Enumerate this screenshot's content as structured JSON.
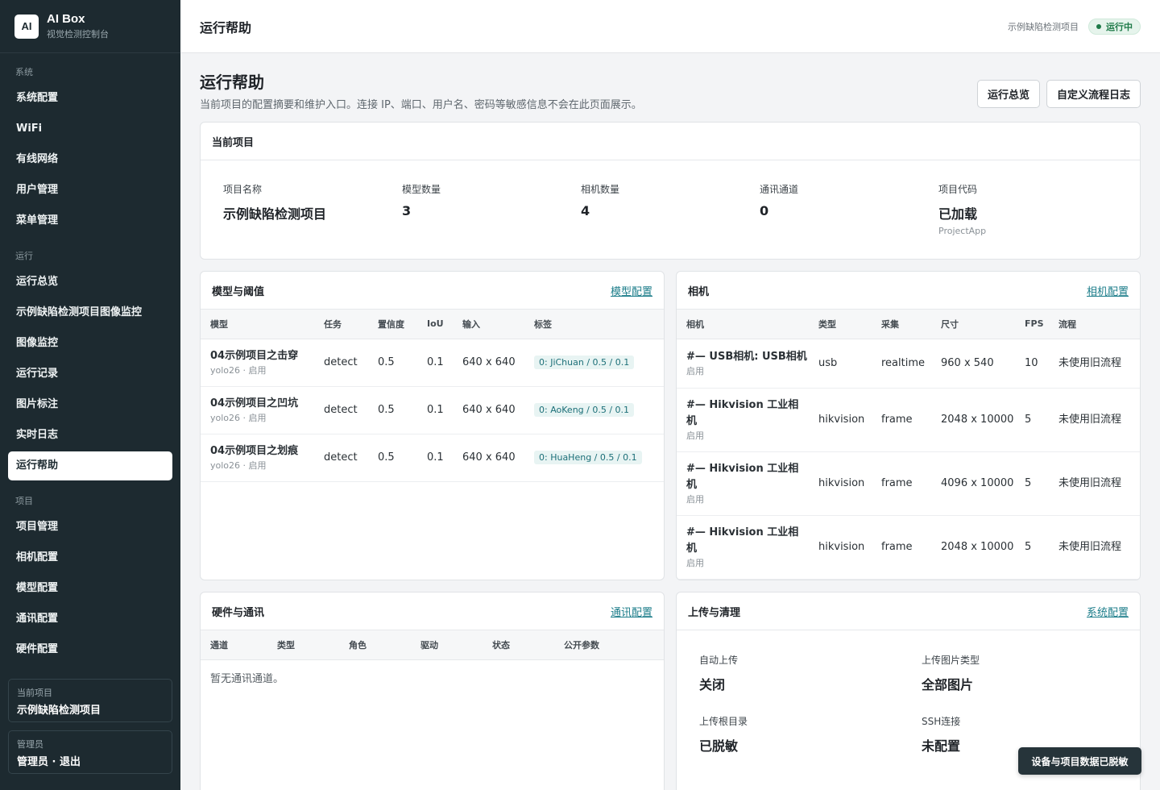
{
  "brand": {
    "logo": "AI",
    "name": "AI Box",
    "subtitle": "视觉检测控制台"
  },
  "sidebar": {
    "groups": [
      {
        "label": "系统",
        "items": [
          "系统配置",
          "WiFi",
          "有线网络",
          "用户管理",
          "菜单管理"
        ]
      },
      {
        "label": "运行",
        "items": [
          "运行总览",
          "示例缺陷检测项目图像监控",
          "图像监控",
          "运行记录",
          "图片标注",
          "实时日志",
          "运行帮助"
        ]
      },
      {
        "label": "项目",
        "items": [
          "项目管理",
          "相机配置",
          "模型配置",
          "通讯配置",
          "硬件配置"
        ]
      }
    ],
    "active": "运行帮助",
    "current_project": {
      "label": "当前项目",
      "value": "示例缺陷检测项目"
    },
    "admin": {
      "label": "管理员",
      "value": "管理员 · 退出"
    }
  },
  "topbar": {
    "title": "运行帮助",
    "project": "示例缺陷检测项目",
    "status": "运行中"
  },
  "page": {
    "title": "运行帮助",
    "description": "当前项目的配置摘要和维护入口。连接 IP、端口、用户名、密码等敏感信息不会在此页面展示。",
    "btn_overview": "运行总览",
    "btn_flow_log": "自定义流程日志"
  },
  "current_project_card": {
    "title": "当前项目",
    "stats": [
      {
        "label": "项目名称",
        "value": "示例缺陷检测项目",
        "sub": ""
      },
      {
        "label": "模型数量",
        "value": "3",
        "sub": ""
      },
      {
        "label": "相机数量",
        "value": "4",
        "sub": ""
      },
      {
        "label": "通讯通道",
        "value": "0",
        "sub": ""
      },
      {
        "label": "项目代码",
        "value": "已加载",
        "sub": "ProjectApp"
      }
    ]
  },
  "models_card": {
    "title": "模型与阈值",
    "link": "模型配置",
    "columns": [
      "模型",
      "任务",
      "置信度",
      "IoU",
      "输入",
      "标签"
    ],
    "rows": [
      {
        "name": "04示例项目之击穿",
        "sub": "yolo26 · 启用",
        "task": "detect",
        "conf": "0.5",
        "iou": "0.1",
        "input": "640 x 640",
        "tag": "0: JiChuan / 0.5 / 0.1"
      },
      {
        "name": "04示例项目之凹坑",
        "sub": "yolo26 · 启用",
        "task": "detect",
        "conf": "0.5",
        "iou": "0.1",
        "input": "640 x 640",
        "tag": "0: AoKeng / 0.5 / 0.1"
      },
      {
        "name": "04示例项目之划痕",
        "sub": "yolo26 · 启用",
        "task": "detect",
        "conf": "0.5",
        "iou": "0.1",
        "input": "640 x 640",
        "tag": "0: HuaHeng / 0.5 / 0.1"
      }
    ]
  },
  "cameras_card": {
    "title": "相机",
    "link": "相机配置",
    "columns": [
      "相机",
      "类型",
      "采集",
      "尺寸",
      "FPS",
      "流程"
    ],
    "rows": [
      {
        "name": "#— USB相机: USB相机",
        "sub": "启用",
        "type": "usb",
        "mode": "realtime",
        "size": "960 x 540",
        "fps": "10",
        "flow": "未使用旧流程"
      },
      {
        "name": "#— Hikvision 工业相机",
        "sub": "启用",
        "type": "hikvision",
        "mode": "frame",
        "size": "2048 x 10000",
        "fps": "5",
        "flow": "未使用旧流程"
      },
      {
        "name": "#— Hikvision 工业相机",
        "sub": "启用",
        "type": "hikvision",
        "mode": "frame",
        "size": "4096 x 10000",
        "fps": "5",
        "flow": "未使用旧流程"
      },
      {
        "name": "#— Hikvision 工业相机",
        "sub": "启用",
        "type": "hikvision",
        "mode": "frame",
        "size": "2048 x 10000",
        "fps": "5",
        "flow": "未使用旧流程"
      }
    ]
  },
  "hardware_card": {
    "title": "硬件与通讯",
    "link": "通讯配置",
    "columns": [
      "通道",
      "类型",
      "角色",
      "驱动",
      "状态",
      "公开参数"
    ],
    "empty": "暂无通讯通道。"
  },
  "upload_card": {
    "title": "上传与清理",
    "link": "系统配置",
    "items": [
      {
        "label": "自动上传",
        "value": "关闭"
      },
      {
        "label": "上传图片类型",
        "value": "全部图片"
      },
      {
        "label": "上传根目录",
        "value": "已脱敏"
      },
      {
        "label": "SSH连接",
        "value": "未配置"
      }
    ]
  },
  "toast": "设备与项目数据已脱敏",
  "colors": {
    "sidebar": "#1d2a30",
    "accent": "#1c7d8a",
    "status_green": "#1e7a48"
  }
}
